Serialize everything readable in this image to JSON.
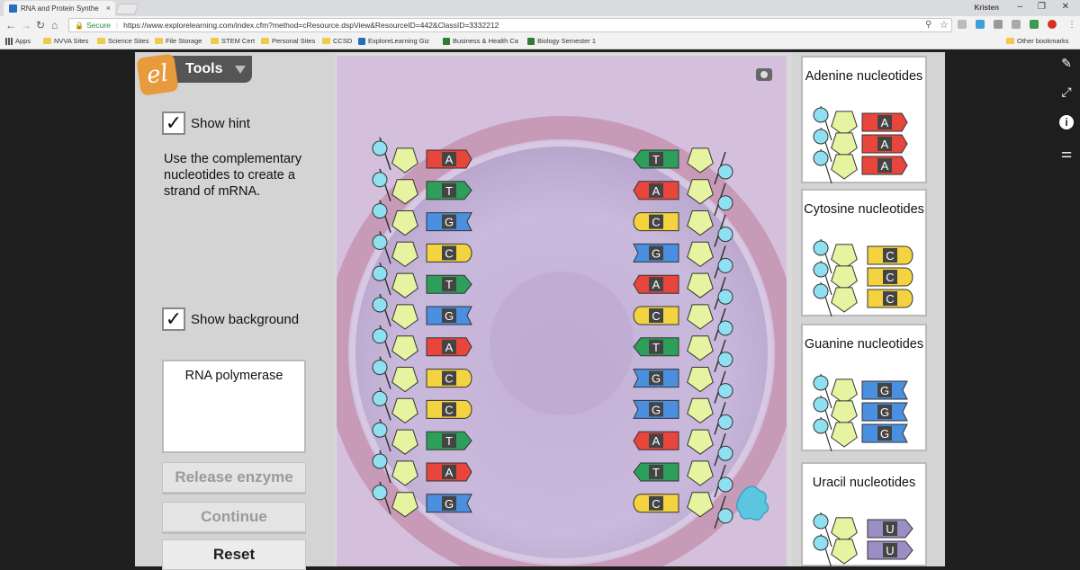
{
  "browser": {
    "tab_title": "RNA and Protein Synthe",
    "tab_close": "×",
    "profile": "Kristen",
    "secure_label": "Secure",
    "url": "https://www.explorelearning.com/index.cfm?method=cResource.dspView&ResourceID=442&ClassID=3332212",
    "bookmarks": [
      "Apps",
      "NVVA Sites",
      "Science Sites",
      "File Storage",
      "STEM Cert",
      "Personal Sites",
      "CCSD",
      "ExploreLearning Giz",
      "Business & Health Ca",
      "Biology Semester 1"
    ],
    "other_bookmarks": "Other bookmarks"
  },
  "tools": {
    "title": "Tools",
    "logo": "el",
    "show_hint_label": "Show hint",
    "show_hint_checked": "✓",
    "hint_text": "Use the complementary nucleotides to create a strand of mRNA.",
    "show_background_label": "Show background",
    "show_background_checked": "✓",
    "enzyme_label": "RNA polymerase",
    "release_button": "Release enzyme",
    "continue_button": "Continue",
    "reset_button": "Reset"
  },
  "dna": {
    "left_strand": [
      "A",
      "T",
      "G",
      "C",
      "T",
      "G",
      "A",
      "C",
      "C",
      "T",
      "A",
      "G"
    ],
    "right_strand": [
      "T",
      "A",
      "C",
      "G",
      "A",
      "C",
      "T",
      "G",
      "G",
      "A",
      "T",
      "C"
    ]
  },
  "colors": {
    "A": "#e8453c",
    "T": "#2e9e5b",
    "G": "#4a8fe0",
    "C": "#f3d340",
    "U": "#9b8ec4",
    "sugar": "#e6f3a0",
    "phosphate": "#8fe0f0"
  },
  "nucleotides": [
    {
      "name": "Adenine nucleotides",
      "base": "A"
    },
    {
      "name": "Cytosine nucleotides",
      "base": "C"
    },
    {
      "name": "Guanine nucleotides",
      "base": "G"
    },
    {
      "name": "Uracil nucleotides",
      "base": "U"
    }
  ]
}
